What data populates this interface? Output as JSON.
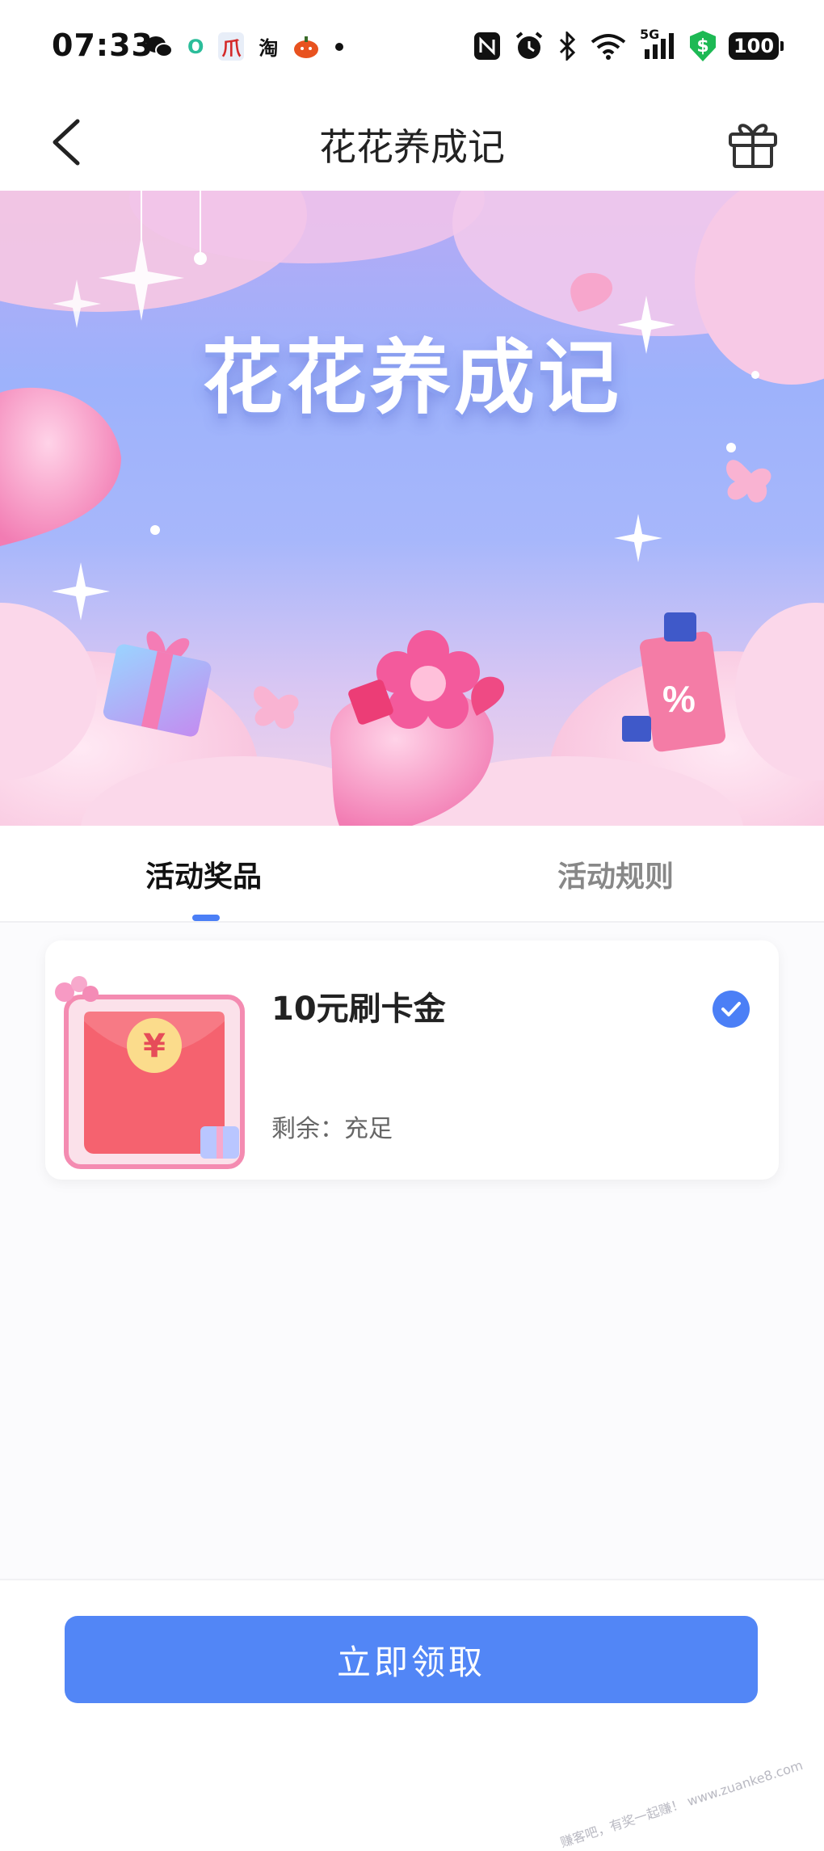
{
  "status_bar": {
    "time": "07:33",
    "left_icons": [
      "wechat-icon",
      "wechat-icon",
      "app-o-icon",
      "app-pdd-icon",
      "taobao-icon",
      "pumpkin-icon",
      "dot-icon"
    ],
    "app_o_label": "O",
    "taobao_label": "淘",
    "pdd_label": "爪",
    "network_label": "5G",
    "battery": "100"
  },
  "nav": {
    "title": "花花养成记"
  },
  "banner": {
    "title": "花花养成记"
  },
  "tabs": {
    "prizes_label": "活动奖品",
    "rules_label": "活动规则",
    "active": "prizes"
  },
  "prize": {
    "name": "10元刷卡金",
    "remaining": "剩余：充足",
    "selected": true,
    "currency_symbol": "¥"
  },
  "footer": {
    "claim_label": "立即领取",
    "watermark": "赚客吧，有奖一起赚！ www.zuanke8.com"
  },
  "colors": {
    "primary": "#5286f6",
    "tab_indicator": "#4b7ff6",
    "red_packet": "#f5626f",
    "banner_sky": "#9db2fb",
    "banner_pink": "#f6d5e8"
  }
}
